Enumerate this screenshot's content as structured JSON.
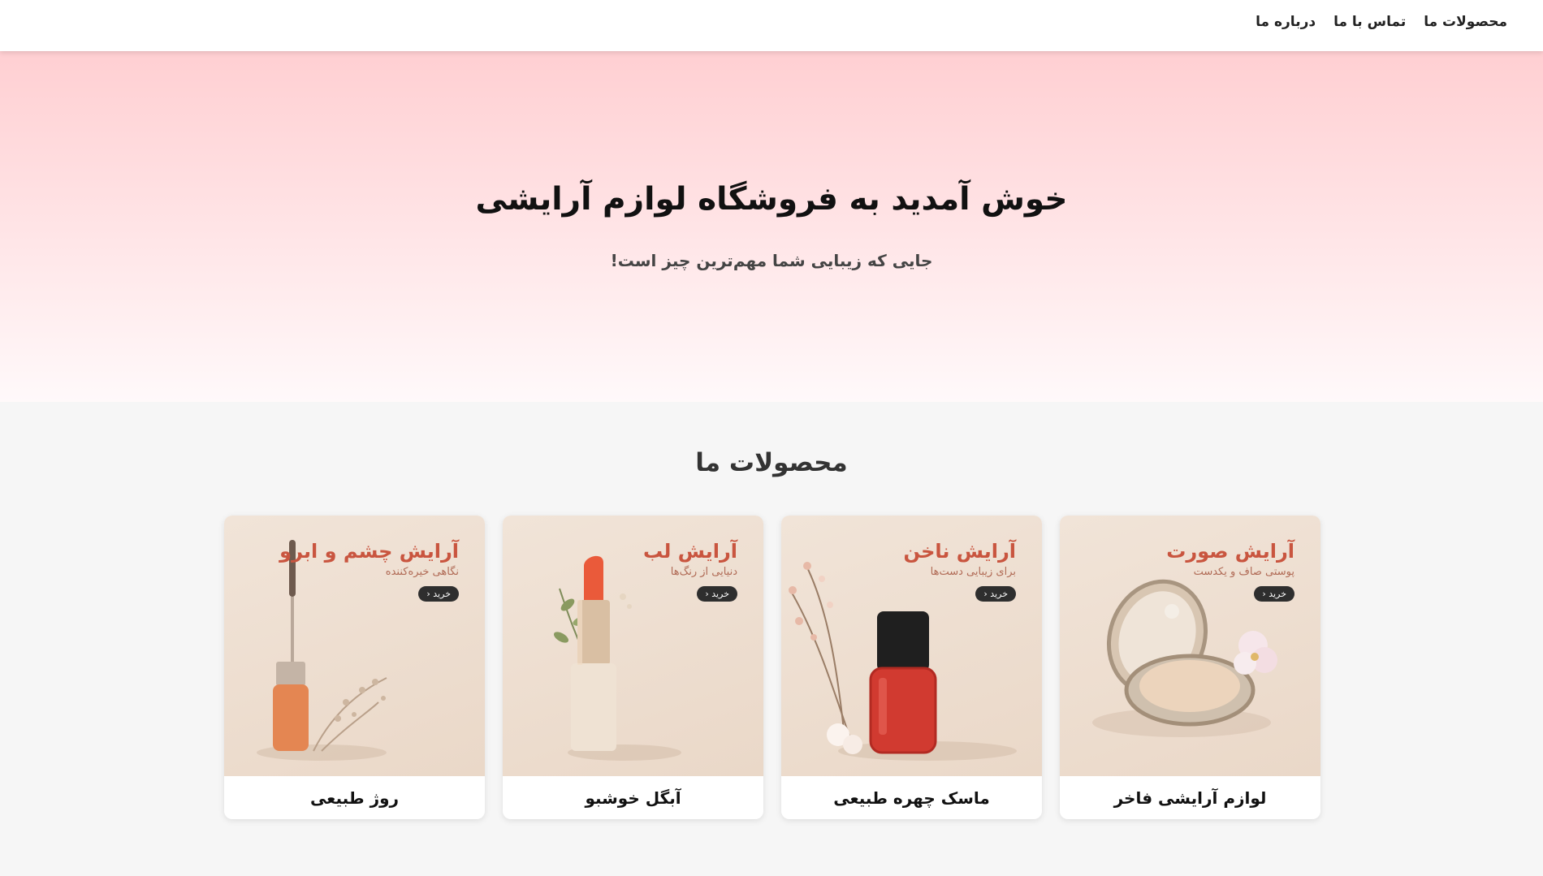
{
  "nav": {
    "items": [
      "درباره ما",
      "تماس با ما",
      "محصولات ما"
    ]
  },
  "hero": {
    "title": "خوش آمدید به فروشگاه لوازم آرایشی",
    "subtitle": "جایی که زیبایی شما مهم‌ترین چیز است!"
  },
  "products": {
    "title": "محصولات ما",
    "items": [
      {
        "promo_title": "آرایش صورت",
        "promo_sub": "پوستی صاف و یکدست",
        "buy": "خرید ‹",
        "name": "لوازم آرایشی فاخر",
        "icon": "compact-powder-icon"
      },
      {
        "promo_title": "آرایش ناخن",
        "promo_sub": "برای زیبایی دست‌ها",
        "buy": "خرید ‹",
        "name": "ماسک چهره طبیعی",
        "icon": "nail-polish-icon"
      },
      {
        "promo_title": "آرایش لب",
        "promo_sub": "دنیایی از رنگ‌ها",
        "buy": "خرید ‹",
        "name": "آبگل خوشبو",
        "icon": "lipstick-icon"
      },
      {
        "promo_title": "آرایش چشم و ابرو",
        "promo_sub": "نگاهی خیره‌کننده",
        "buy": "خرید ‹",
        "name": "روژ طبیعی",
        "icon": "mascara-icon"
      }
    ]
  },
  "colors": {
    "hero_top": "#ffcfd2",
    "promo_title": "#c9553f",
    "buy_button": "#2e2e2e"
  }
}
